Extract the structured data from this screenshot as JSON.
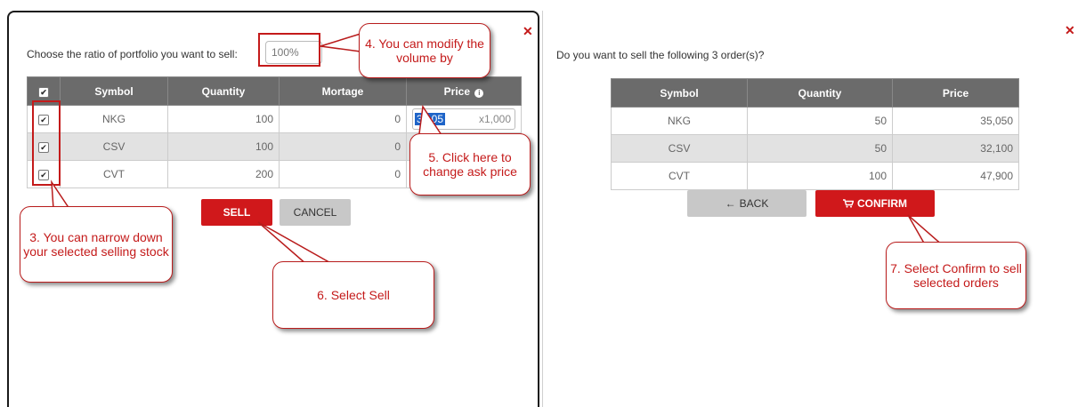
{
  "sell_dialog": {
    "ratio_label": "Choose the ratio of portfolio you want to sell:",
    "ratio_value": "100%",
    "close_icon": "✕",
    "columns": [
      "Symbol",
      "Quantity",
      "Mortage",
      "Price"
    ],
    "price_info_icon": "info-icon",
    "rows": [
      {
        "symbol": "NKG",
        "quantity": "100",
        "mortgage": "0",
        "price": "35.05",
        "unit": "x1,000",
        "checked": true
      },
      {
        "symbol": "CSV",
        "quantity": "100",
        "mortgage": "0",
        "checked": true
      },
      {
        "symbol": "CVT",
        "quantity": "200",
        "mortgage": "0",
        "checked": true
      }
    ],
    "sell_label": "SELL",
    "cancel_label": "CANCEL"
  },
  "confirm_dialog": {
    "question": "Do you want to sell the following 3 order(s)?",
    "close_icon": "✕",
    "columns": [
      "Symbol",
      "Quantity",
      "Price"
    ],
    "rows": [
      {
        "symbol": "NKG",
        "quantity": "50",
        "price": "35,050"
      },
      {
        "symbol": "CSV",
        "quantity": "50",
        "price": "32,100"
      },
      {
        "symbol": "CVT",
        "quantity": "100",
        "price": "47,900"
      }
    ],
    "back_label": "BACK",
    "confirm_label": "CONFIRM"
  },
  "callouts": {
    "c3": "3. You can narrow down your selected selling stock",
    "c4": "4. You can modify the volume by",
    "c5": "5. Click here to change ask price",
    "c6": "6. Select Sell",
    "c7": "7. Select Confirm to sell selected orders"
  },
  "colors": {
    "accent_red": "#d0181b",
    "header_grey": "#6b6b6b",
    "callout_red": "#c41a1a"
  }
}
